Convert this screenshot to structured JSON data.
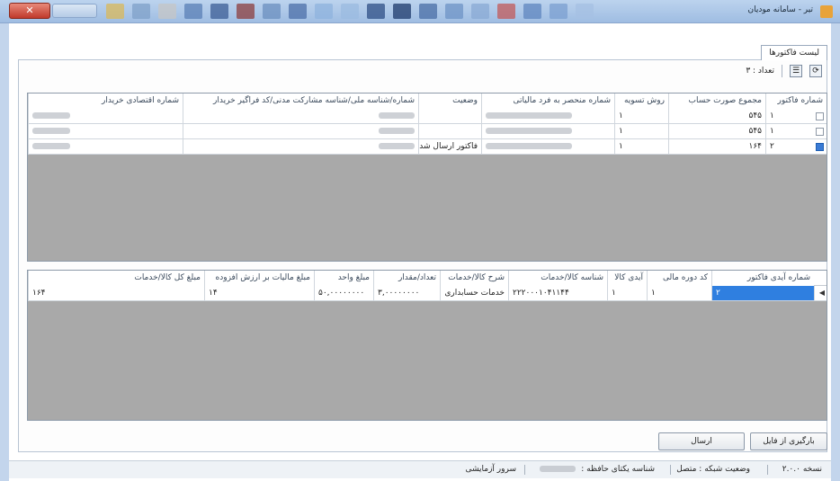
{
  "window": {
    "title": "تیر - سامانه مودیان"
  },
  "tabs": [
    {
      "label": "لیست فاکتورها"
    }
  ],
  "toolbar": {
    "count_label": "تعداد : ۳"
  },
  "invoices": {
    "columns": [
      "شماره فاکتور",
      "مجموع صورت حساب",
      "روش تسویه",
      "شماره منحصر به فرد مالیاتی",
      "وضعیت",
      "شماره/شناسه ملی/شناسه مشارکت مدنی/کد فراگیر خریدار",
      "شماره اقتصادی خریدار"
    ],
    "rows": [
      {
        "invoice_no": "۱",
        "total": "۵۴۵",
        "settlement": "۱",
        "status": "",
        "checked": false
      },
      {
        "invoice_no": "۱",
        "total": "۵۴۵",
        "settlement": "۱",
        "status": "",
        "checked": false
      },
      {
        "invoice_no": "۲",
        "total": "۱۶۴",
        "settlement": "۱",
        "status": "فاکتور ارسال شد",
        "checked": true
      }
    ]
  },
  "items": {
    "columns": [
      "شماره آیدی فاکتور",
      "کد دوره مالی",
      "آیدی کالا",
      "شناسه کالا/خدمات",
      "شرح کالا/خدمات",
      "تعداد/مقدار",
      "مبلغ واحد",
      "مبلغ مالیات بر ارزش افزوده",
      "مبلغ کل کالا/خدمات"
    ],
    "rows": [
      {
        "invoice_id": "۲",
        "period_code": "۱",
        "product_id": "۱",
        "product_code": "۲۲۲۰۰۰۱۰۴۱۱۴۴",
        "description": "خدمات حسابداری",
        "quantity": "۳,۰۰۰۰۰۰۰۰",
        "unit_price": "۵۰,۰۰۰۰۰۰۰۰",
        "vat": "۱۴",
        "total": "۱۶۴"
      }
    ]
  },
  "buttons": {
    "load_file": "بارگیری از فایل",
    "send": "ارسال"
  },
  "statusbar": {
    "version": "نسخه ۲.۰.۰",
    "network_status": "وضعیت شبکه : متصل",
    "memory_id_label": "شناسه یکتای حافظه :",
    "server": "سرور آزمایشی"
  }
}
